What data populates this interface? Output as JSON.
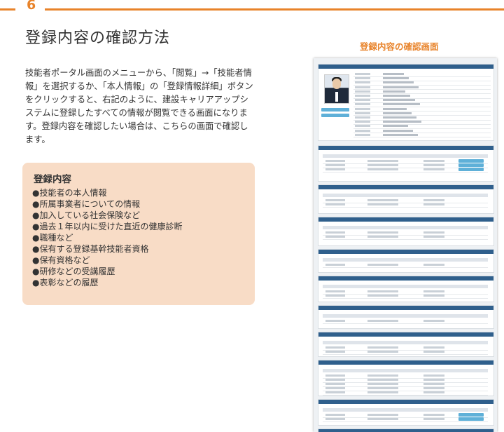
{
  "section_number": "6",
  "page_title": "登録内容の確認方法",
  "screen_title": "登録内容の確認画面",
  "intro_text": "技能者ポータル画面のメニューから、「閲覧」→「技能者情報」を選択するか、「本人情報」の「登録情報詳細」ボタンをクリックすると、右記のように、建設キャリアアップシステムに登録したすべての情報が閲覧できる画面になります。登録内容を確認したい場合は、こちらの画面で確認します。",
  "registered_contents": {
    "title": "登録内容",
    "items": [
      "●技能者の本人情報",
      "●所属事業者についての情報",
      "●加入している社会保険など",
      "●過去１年以内に受けた直近の健康診断",
      "●職種など",
      "●保有する登録基幹技能者資格",
      "●保有資格など",
      "●研修などの受講履歴",
      "●表彰などの履歴"
    ]
  },
  "colors": {
    "accent": "#e8832a",
    "box_background": "#f8dcc6",
    "screen_header": "#2f5f8c",
    "screen_button": "#5fb0d8"
  }
}
